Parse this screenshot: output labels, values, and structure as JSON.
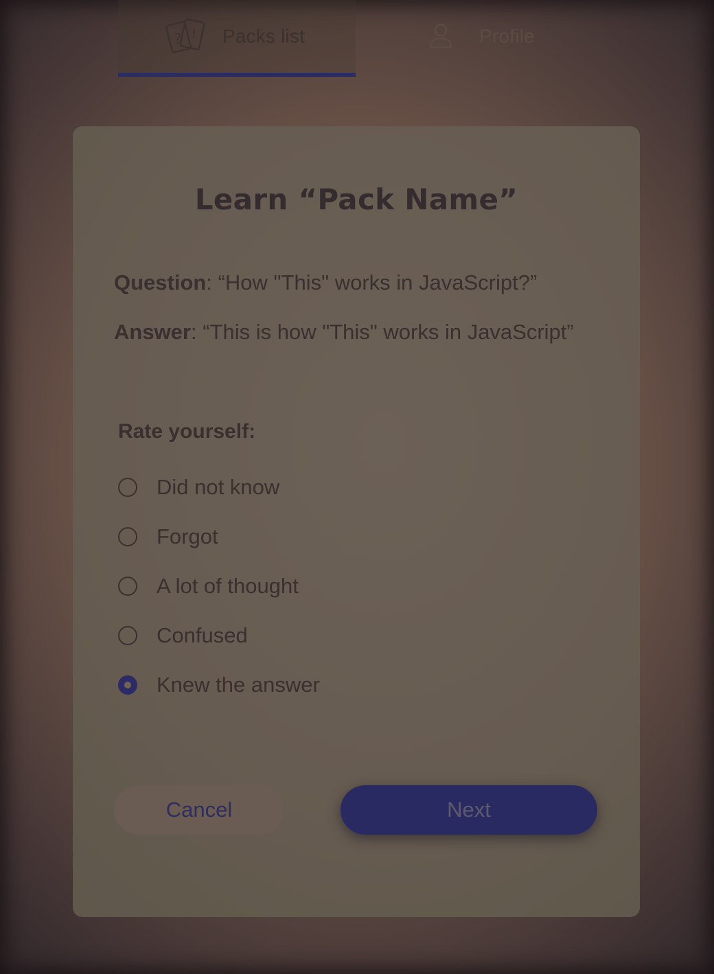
{
  "tabs": {
    "packs": {
      "label": "Packs list",
      "icon": "cards-icon",
      "active": true
    },
    "profile": {
      "label": "Profile",
      "icon": "user-icon",
      "active": false
    }
  },
  "card": {
    "title": "Learn “Pack Name”",
    "question": {
      "label": "Question",
      "separator": ": ",
      "text": "“How \"This\" works in JavaScript?”"
    },
    "answer": {
      "label": "Answer",
      "separator": ": ",
      "text": "“This is how \"This\" works in JavaScript”"
    },
    "rate": {
      "title": "Rate yourself:",
      "options": [
        {
          "label": "Did not know",
          "checked": false
        },
        {
          "label": "Forgot",
          "checked": false
        },
        {
          "label": "A lot of thought",
          "checked": false
        },
        {
          "label": "Confused",
          "checked": false
        },
        {
          "label": "Knew the answer",
          "checked": true
        }
      ]
    },
    "buttons": {
      "cancel": "Cancel",
      "next": "Next"
    }
  },
  "colors": {
    "accent": "#2b2c63",
    "overlay_tint": "#6a5c52"
  }
}
